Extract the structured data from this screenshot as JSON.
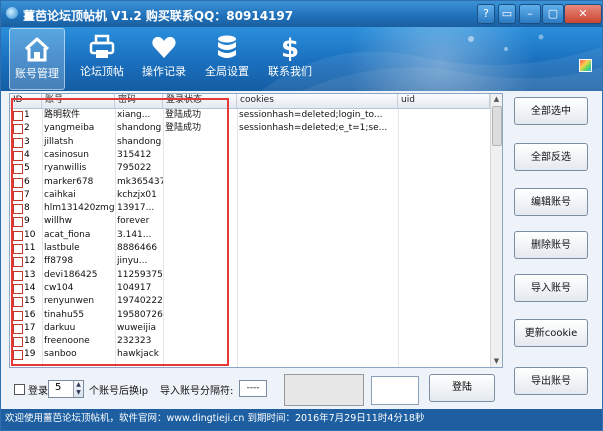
{
  "window": {
    "title": "薑芭论坛顶帖机 V1.2 购买联系QQ：80914197",
    "window_buttons": [
      "?",
      "▭",
      "–",
      "▢",
      "✕"
    ]
  },
  "ribbon": {
    "items": [
      {
        "label": "账号管理",
        "icon": "home-icon",
        "active": true
      },
      {
        "label": "论坛顶帖",
        "icon": "printer-icon",
        "active": false
      },
      {
        "label": "操作记录",
        "icon": "heart-icon",
        "active": false
      },
      {
        "label": "全局设置",
        "icon": "database-icon",
        "active": false
      },
      {
        "label": "联系我们",
        "icon": "dollar-icon",
        "active": false
      }
    ]
  },
  "table": {
    "columns": [
      "ID",
      "账号",
      "密码",
      "登录状态",
      "cookies",
      "uid"
    ],
    "rows": [
      {
        "id": "1",
        "account": "路明软件",
        "password": "xiang...",
        "status": "登陆成功",
        "cookies": "sessionhash=deleted;login_to...",
        "uid": ""
      },
      {
        "id": "2",
        "account": "yangmeiba",
        "password": "shandong",
        "status": "登陆成功",
        "cookies": "sessionhash=deleted;e_t=1;se...",
        "uid": ""
      },
      {
        "id": "3",
        "account": "jillatsh",
        "password": "shandong",
        "status": "",
        "cookies": "",
        "uid": ""
      },
      {
        "id": "4",
        "account": "casinosun",
        "password": "315412",
        "status": "",
        "cookies": "",
        "uid": ""
      },
      {
        "id": "5",
        "account": "ryanwillis",
        "password": "795022",
        "status": "",
        "cookies": "",
        "uid": ""
      },
      {
        "id": "6",
        "account": "marker678",
        "password": "mk365437",
        "status": "",
        "cookies": "",
        "uid": ""
      },
      {
        "id": "7",
        "account": "caihkai",
        "password": "kchzjx01",
        "status": "",
        "cookies": "",
        "uid": ""
      },
      {
        "id": "8",
        "account": "hlm131420zmg",
        "password": "13917...",
        "status": "",
        "cookies": "",
        "uid": ""
      },
      {
        "id": "9",
        "account": "willhw",
        "password": "forever",
        "status": "",
        "cookies": "",
        "uid": ""
      },
      {
        "id": "10",
        "account": "acat_fiona",
        "password": "3.141...",
        "status": "",
        "cookies": "",
        "uid": ""
      },
      {
        "id": "11",
        "account": "lastbule",
        "password": "8886466",
        "status": "",
        "cookies": "",
        "uid": ""
      },
      {
        "id": "12",
        "account": "ff8798",
        "password": "jinyu...",
        "status": "",
        "cookies": "",
        "uid": ""
      },
      {
        "id": "13",
        "account": "devi186425",
        "password": "11259375",
        "status": "",
        "cookies": "",
        "uid": ""
      },
      {
        "id": "14",
        "account": "cw104",
        "password": "104917",
        "status": "",
        "cookies": "",
        "uid": ""
      },
      {
        "id": "15",
        "account": "renyunwen",
        "password": "19740222",
        "status": "",
        "cookies": "",
        "uid": ""
      },
      {
        "id": "16",
        "account": "tinahu55",
        "password": "19580726",
        "status": "",
        "cookies": "",
        "uid": ""
      },
      {
        "id": "17",
        "account": "darkuu",
        "password": "wuweijia",
        "status": "",
        "cookies": "",
        "uid": ""
      },
      {
        "id": "18",
        "account": "freenoone",
        "password": "232323",
        "status": "",
        "cookies": "",
        "uid": ""
      },
      {
        "id": "19",
        "account": "sanboo",
        "password": "hawkjack",
        "status": "",
        "cookies": "",
        "uid": ""
      }
    ]
  },
  "side_buttons": [
    "全部选中",
    "全部反选",
    "编辑账号",
    "删除账号",
    "导入账号",
    "更新cookie",
    "导出账号"
  ],
  "bottom": {
    "login_label": "登录",
    "count_value": "5",
    "count_suffix": "个账号后换ip",
    "separator_label": "导入账号分隔符:",
    "separator_value": "----",
    "login_button": "登陆"
  },
  "status_bar": {
    "text": "欢迎使用薑芭论坛顶帖机，软件官网：www.dingtieji.cn 到期时间：2016年7月29日11时4分18秒"
  },
  "colors": {
    "ribbon": "#1a6fbd",
    "title_bar": "#2a7fc8",
    "status_bar": "#1d5fa1",
    "highlight_box": "#e53935",
    "checkbox_border": "#c0392b"
  }
}
